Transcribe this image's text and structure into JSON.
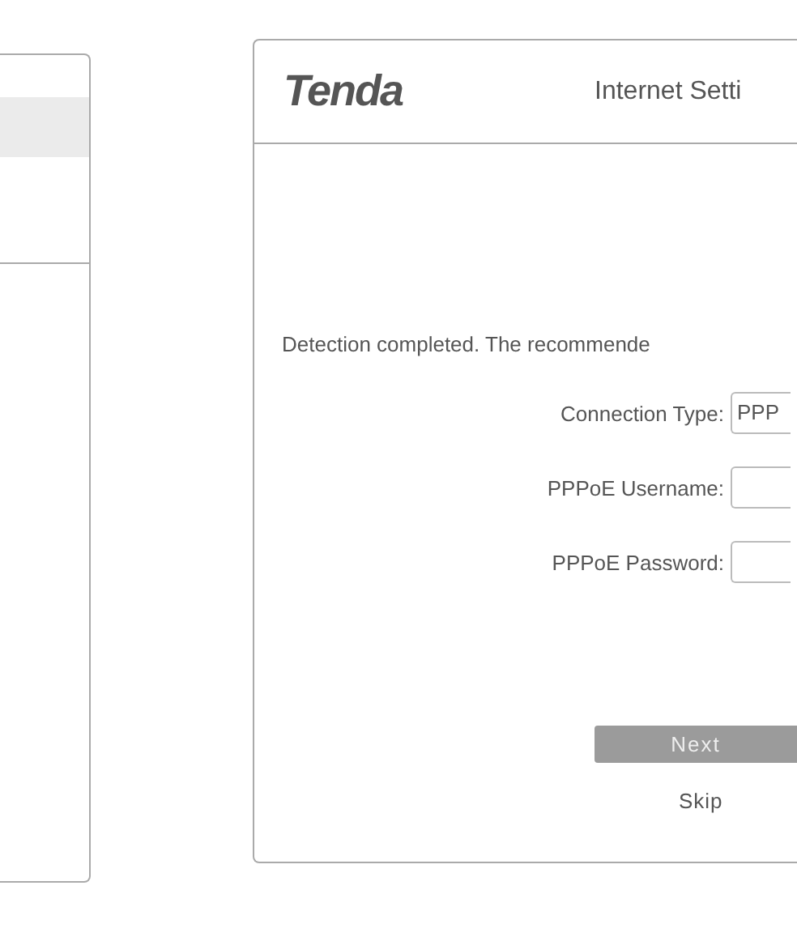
{
  "header": {
    "logo": "Tenda",
    "title": "Internet Setti"
  },
  "message": "Detection completed. The recommende",
  "fields": [
    {
      "label": "Connection Type:",
      "kind": "select",
      "value": "PPP"
    },
    {
      "label": "PPPoE Username:",
      "kind": "input"
    },
    {
      "label": "PPPoE Password:",
      "kind": "password"
    }
  ],
  "buttons": [
    {
      "label": "Next",
      "kind": "primary"
    },
    {
      "label": "Skip",
      "kind": "link"
    }
  ]
}
